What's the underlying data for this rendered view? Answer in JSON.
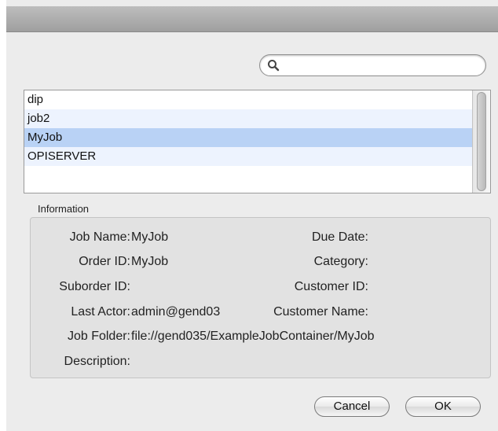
{
  "search": {
    "value": "",
    "placeholder": ""
  },
  "jobs": [
    "dip",
    "job2",
    "MyJob",
    "OPISERVER"
  ],
  "selected_job": "MyJob",
  "information": {
    "title": "Information",
    "job_name": {
      "label": "Job Name:",
      "value": "MyJob"
    },
    "order_id": {
      "label": "Order ID:",
      "value": "MyJob"
    },
    "suborder_id": {
      "label": "Suborder ID:",
      "value": ""
    },
    "last_actor": {
      "label": "Last Actor:",
      "value": "admin@gend03"
    },
    "job_folder": {
      "label": "Job Folder:",
      "value": "file://gend035/ExampleJobContainer/MyJob"
    },
    "description": {
      "label": "Description:",
      "value": ""
    },
    "due_date": {
      "label": "Due Date:",
      "value": ""
    },
    "category": {
      "label": "Category:",
      "value": ""
    },
    "customer_id": {
      "label": "Customer ID:",
      "value": ""
    },
    "customer_name": {
      "label": "Customer Name:",
      "value": ""
    }
  },
  "buttons": {
    "cancel": "Cancel",
    "ok": "OK"
  },
  "icons": {
    "search": "search-icon"
  },
  "colors": {
    "selection": "#b9d2f5",
    "alt_row": "#edf3fe",
    "panel": "#ececec"
  }
}
